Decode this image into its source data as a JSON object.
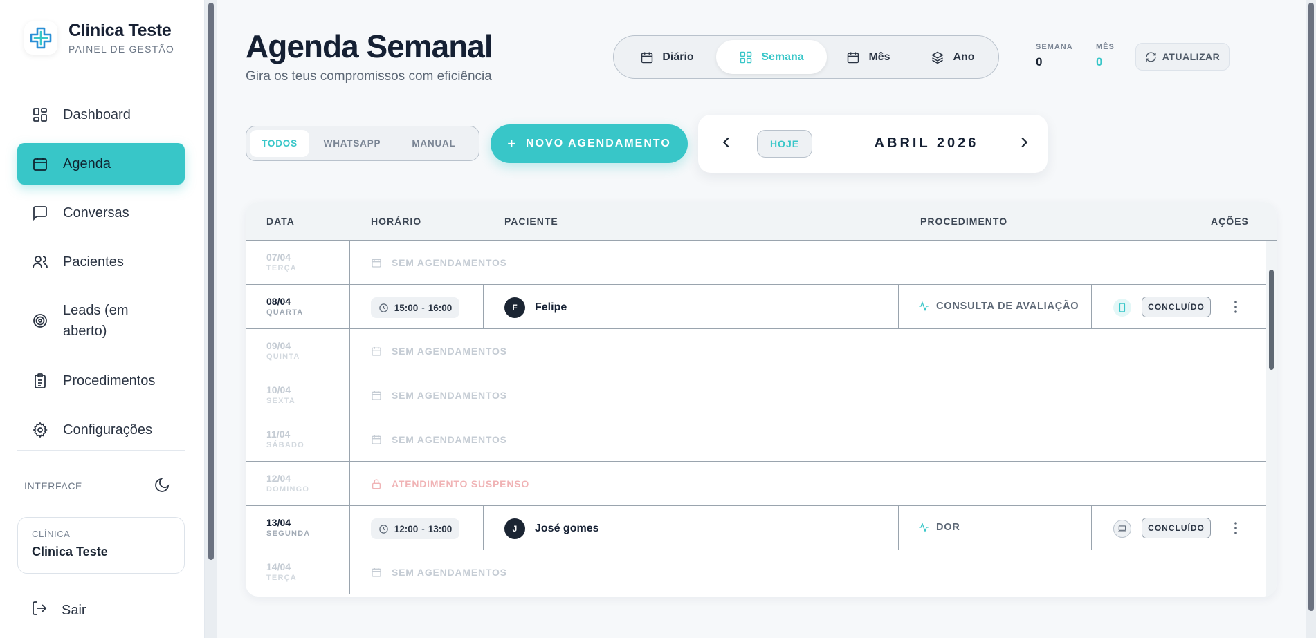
{
  "brand": {
    "name": "Clinica Teste",
    "subtitle": "PAINEL DE GESTÃO"
  },
  "sidebar": {
    "items": [
      {
        "label": "Dashboard",
        "icon": "layout-dashboard-icon"
      },
      {
        "label": "Agenda",
        "icon": "calendar-icon",
        "active": true
      },
      {
        "label": "Conversas",
        "icon": "message-square-icon"
      },
      {
        "label": "Pacientes",
        "icon": "users-icon"
      },
      {
        "label": "Leads (em aberto)",
        "icon": "target-icon"
      },
      {
        "label": "Procedimentos",
        "icon": "clipboard-list-icon"
      },
      {
        "label": "Configurações",
        "icon": "gear-icon"
      }
    ],
    "interface_label": "INTERFACE",
    "clinic_key": "CLÍNICA",
    "clinic_value": "Clinica Teste",
    "logout": "Sair"
  },
  "header": {
    "title": "Agenda Semanal",
    "subtitle": "Gira os teus compromissos com eficiência",
    "view_tabs": [
      {
        "label": "Diário",
        "icon": "calendar-icon"
      },
      {
        "label": "Semana",
        "icon": "grid-icon",
        "active": true
      },
      {
        "label": "Mês",
        "icon": "calendar-icon"
      },
      {
        "label": "Ano",
        "icon": "layers-icon"
      }
    ],
    "stats": [
      {
        "key": "SEMANA",
        "value": "0",
        "color": "#1b2533"
      },
      {
        "key": "MÊS",
        "value": "0",
        "color": "#38c6c8"
      }
    ],
    "refresh": "ATUALIZAR"
  },
  "toolbar": {
    "filters": [
      {
        "label": "TODOS",
        "active": true
      },
      {
        "label": "WHATSAPP"
      },
      {
        "label": "MANUAL"
      }
    ],
    "new_button": "NOVO AGENDAMENTO",
    "today": "HOJE",
    "month": "ABRIL 2026"
  },
  "table": {
    "columns": {
      "date": "DATA",
      "time": "HORÁRIO",
      "patient": "PACIENTE",
      "procedure": "PROCEDIMENTO",
      "actions": "AÇÕES"
    },
    "rows": [
      {
        "date": "07/04",
        "weekday": "TERÇA",
        "empty": "SEM AGENDAMENTOS"
      },
      {
        "date": "08/04",
        "weekday": "QUARTA",
        "start": "15:00",
        "end": "16:00",
        "initial": "F",
        "patient": "Felipe",
        "procedure": "CONSULTA DE AVALIAÇÃO",
        "channel": "smartphone-icon",
        "status": "CONCLUÍDO"
      },
      {
        "date": "09/04",
        "weekday": "QUINTA",
        "empty": "SEM AGENDAMENTOS"
      },
      {
        "date": "10/04",
        "weekday": "SEXTA",
        "empty": "SEM AGENDAMENTOS"
      },
      {
        "date": "11/04",
        "weekday": "SÁBADO",
        "empty": "SEM AGENDAMENTOS"
      },
      {
        "date": "12/04",
        "weekday": "DOMINGO",
        "suspended": "ATENDIMENTO SUSPENSO"
      },
      {
        "date": "13/04",
        "weekday": "SEGUNDA",
        "start": "12:00",
        "end": "13:00",
        "initial": "J",
        "patient": "José gomes",
        "procedure": "DOR",
        "channel": "laptop-icon",
        "status": "CONCLUÍDO"
      },
      {
        "date": "14/04",
        "weekday": "TERÇA",
        "empty": "SEM AGENDAMENTOS"
      }
    ]
  },
  "colors": {
    "accent": "#38c6c8",
    "danger_soft": "#f0b3b5"
  }
}
